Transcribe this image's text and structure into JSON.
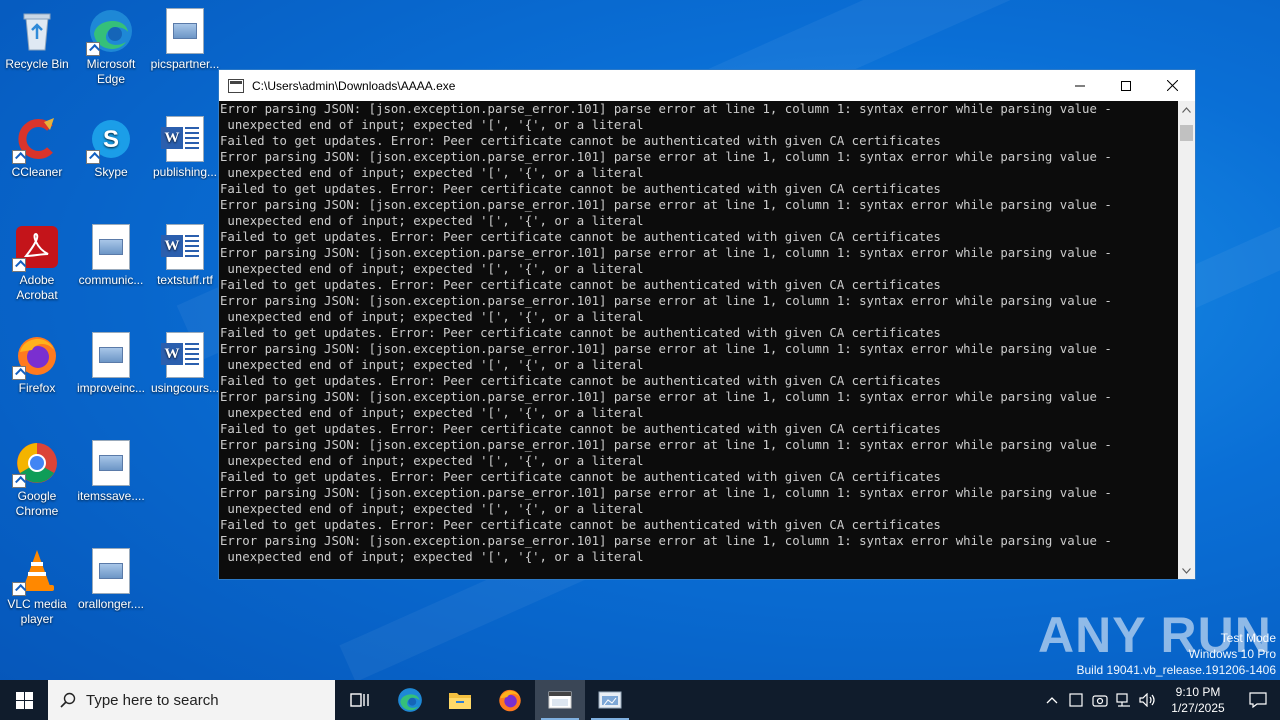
{
  "desktop": {
    "icons": [
      {
        "label": "Recycle Bin"
      },
      {
        "label": "Microsoft Edge"
      },
      {
        "label": "picspartner..."
      },
      {
        "label": "CCleaner"
      },
      {
        "label": "Skype"
      },
      {
        "label": "publishing..."
      },
      {
        "label": "Adobe Acrobat"
      },
      {
        "label": "communic..."
      },
      {
        "label": "textstuff.rtf"
      },
      {
        "label": "Firefox"
      },
      {
        "label": "improveinc..."
      },
      {
        "label": "usingcours..."
      },
      {
        "label": "Google Chrome"
      },
      {
        "label": "itemssave...."
      },
      {
        "label": "VLC media player"
      },
      {
        "label": "orallonger...."
      }
    ]
  },
  "window": {
    "title": "C:\\Users\\admin\\Downloads\\AAAA.exe",
    "minimize_glyph": "—",
    "maximize_glyph": "☐",
    "close_glyph": "✕",
    "console_lines": [
      "Error parsing JSON: [json.exception.parse_error.101] parse error at line 1, column 1: syntax error while parsing value -",
      " unexpected end of input; expected '[', '{', or a literal",
      "Failed to get updates. Error: Peer certificate cannot be authenticated with given CA certificates",
      "Error parsing JSON: [json.exception.parse_error.101] parse error at line 1, column 1: syntax error while parsing value -",
      " unexpected end of input; expected '[', '{', or a literal",
      "Failed to get updates. Error: Peer certificate cannot be authenticated with given CA certificates",
      "Error parsing JSON: [json.exception.parse_error.101] parse error at line 1, column 1: syntax error while parsing value -",
      " unexpected end of input; expected '[', '{', or a literal",
      "Failed to get updates. Error: Peer certificate cannot be authenticated with given CA certificates",
      "Error parsing JSON: [json.exception.parse_error.101] parse error at line 1, column 1: syntax error while parsing value -",
      " unexpected end of input; expected '[', '{', or a literal",
      "Failed to get updates. Error: Peer certificate cannot be authenticated with given CA certificates",
      "Error parsing JSON: [json.exception.parse_error.101] parse error at line 1, column 1: syntax error while parsing value -",
      " unexpected end of input; expected '[', '{', or a literal",
      "Failed to get updates. Error: Peer certificate cannot be authenticated with given CA certificates",
      "Error parsing JSON: [json.exception.parse_error.101] parse error at line 1, column 1: syntax error while parsing value -",
      " unexpected end of input; expected '[', '{', or a literal",
      "Failed to get updates. Error: Peer certificate cannot be authenticated with given CA certificates",
      "Error parsing JSON: [json.exception.parse_error.101] parse error at line 1, column 1: syntax error while parsing value -",
      " unexpected end of input; expected '[', '{', or a literal",
      "Failed to get updates. Error: Peer certificate cannot be authenticated with given CA certificates",
      "Error parsing JSON: [json.exception.parse_error.101] parse error at line 1, column 1: syntax error while parsing value -",
      " unexpected end of input; expected '[', '{', or a literal",
      "Failed to get updates. Error: Peer certificate cannot be authenticated with given CA certificates",
      "Error parsing JSON: [json.exception.parse_error.101] parse error at line 1, column 1: syntax error while parsing value -",
      " unexpected end of input; expected '[', '{', or a literal",
      "Failed to get updates. Error: Peer certificate cannot be authenticated with given CA certificates",
      "Error parsing JSON: [json.exception.parse_error.101] parse error at line 1, column 1: syntax error while parsing value -",
      " unexpected end of input; expected '[', '{', or a literal"
    ]
  },
  "watermark": {
    "brand": "ANY RUN",
    "line1": "Test Mode",
    "line2": "Windows 10 Pro",
    "line3": "Build 19041.vb_release.191206-1406"
  },
  "taskbar": {
    "search_placeholder": "Type here to search",
    "clock_time": "9:10 PM",
    "clock_date": "1/27/2025"
  },
  "colors": {
    "desktop_blue": "#0a6fd6",
    "console_bg": "#0c0c0c",
    "console_text": "#cccccc",
    "taskbar_bg": "#101c2c"
  }
}
